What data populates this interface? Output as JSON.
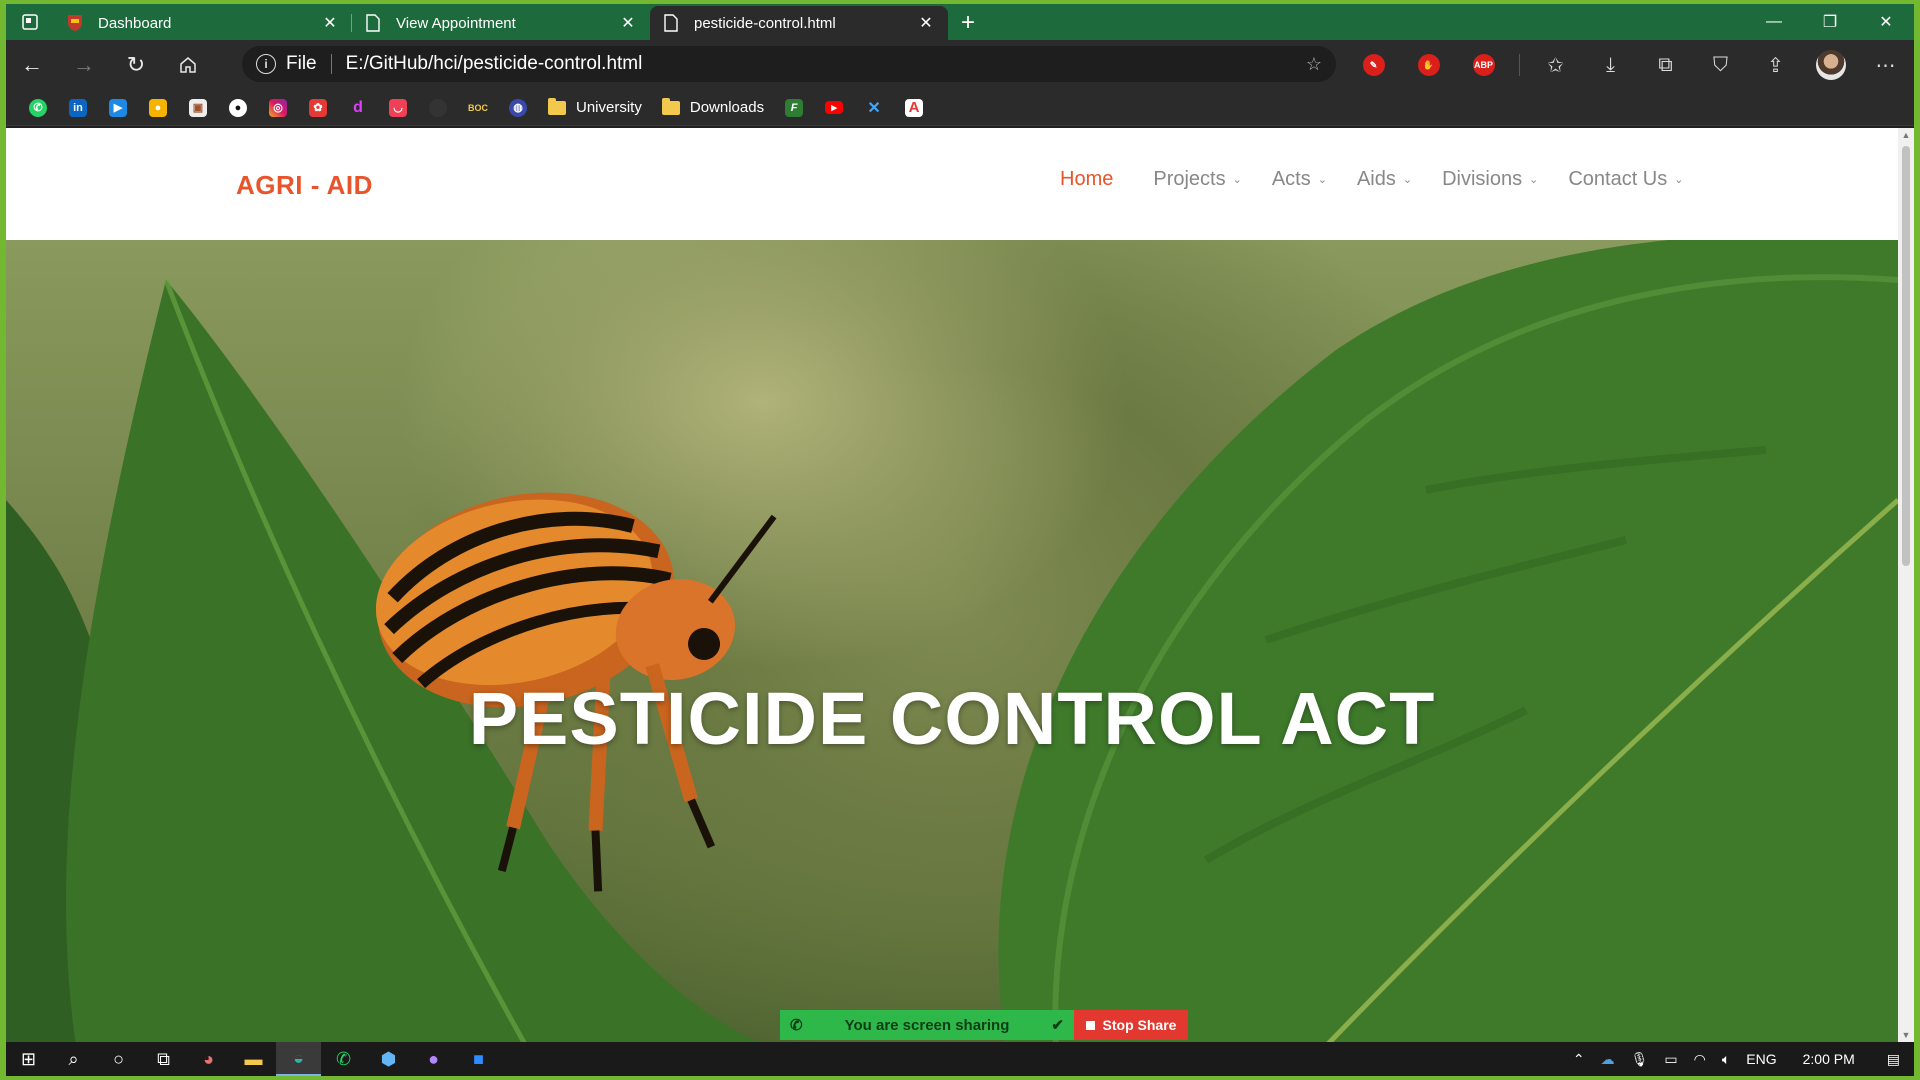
{
  "browser": {
    "tabs": [
      {
        "title": "Dashboard",
        "active": false
      },
      {
        "title": "View Appointment",
        "active": false
      },
      {
        "title": "pesticide-control.html",
        "active": true
      }
    ],
    "address": {
      "scheme": "File",
      "url": "E:/GitHub/hci/pesticide-control.html"
    },
    "extensions": [
      "pen-tool-icon",
      "hand-block-icon",
      "adblock-plus-icon"
    ],
    "extensions_abp_label": "ABP",
    "bookmarks": [
      {
        "icon": "whatsapp-icon",
        "label": ""
      },
      {
        "icon": "linkedin-icon",
        "label": ""
      },
      {
        "icon": "video-icon",
        "label": ""
      },
      {
        "icon": "camera-icon",
        "label": ""
      },
      {
        "icon": "portal-icon",
        "label": ""
      },
      {
        "icon": "github-icon",
        "label": ""
      },
      {
        "icon": "instagram-icon",
        "label": ""
      },
      {
        "icon": "huawei-icon",
        "label": ""
      },
      {
        "icon": "d-icon",
        "label": ""
      },
      {
        "icon": "pocket-icon",
        "label": ""
      },
      {
        "icon": "circle-icon",
        "label": ""
      },
      {
        "icon": "boc-icon",
        "label": "BOC"
      },
      {
        "icon": "globe-icon",
        "label": ""
      },
      {
        "icon": "folder-icon",
        "label": "University"
      },
      {
        "icon": "folder-icon",
        "label": "Downloads"
      },
      {
        "icon": "f-icon",
        "label": ""
      },
      {
        "icon": "youtube-icon",
        "label": ""
      },
      {
        "icon": "x-tool-icon",
        "label": ""
      },
      {
        "icon": "adobe-icon",
        "label": ""
      }
    ]
  },
  "site": {
    "logo": "AGRI - AID",
    "nav": [
      {
        "label": "Home",
        "active": true,
        "dropdown": false
      },
      {
        "label": "Projects",
        "active": false,
        "dropdown": true
      },
      {
        "label": "Acts",
        "active": false,
        "dropdown": true
      },
      {
        "label": "Aids",
        "active": false,
        "dropdown": true
      },
      {
        "label": "Divisions",
        "active": false,
        "dropdown": true
      },
      {
        "label": "Contact Us",
        "active": false,
        "dropdown": true
      }
    ],
    "hero_title": "PESTICIDE CONTROL ACT",
    "accent_color": "#e8542b"
  },
  "screen_share": {
    "status": "You are screen sharing",
    "stop_label": "Stop Share"
  },
  "taskbar": {
    "apps": [
      "windows-start-icon",
      "search-icon",
      "cortana-icon",
      "task-view-icon",
      "app-icon",
      "file-explorer-icon",
      "edge-icon",
      "whatsapp-icon",
      "box-icon",
      "github-desktop-icon",
      "zoom-icon"
    ],
    "language": "ENG",
    "time": "2:00 PM"
  }
}
